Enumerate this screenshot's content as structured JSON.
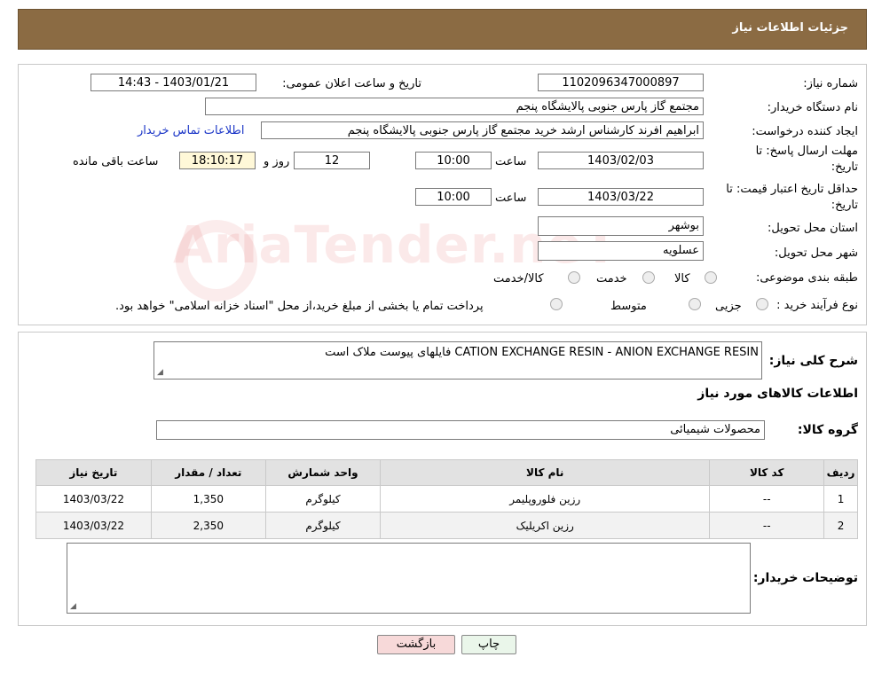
{
  "header": {
    "title": "جزئیات اطلاعات نیاز"
  },
  "form": {
    "need_number_label": "شماره نیاز:",
    "need_number": "1102096347000897",
    "announce_label": "تاریخ و ساعت اعلان عمومی:",
    "announce_value": "1403/01/21 - 14:43",
    "buyer_org_label": "نام دستگاه خریدار:",
    "buyer_org": "مجتمع گاز پارس جنوبی  پالایشگاه پنجم",
    "creator_label": "ایجاد کننده درخواست:",
    "creator": "ابراهیم افرند کارشناس ارشد خرید مجتمع گاز پارس جنوبی  پالایشگاه پنجم",
    "contact_link": "اطلاعات تماس خریدار",
    "deadline_label_1": "مهلت ارسال پاسخ: تا",
    "deadline_label_2": "تاریخ:",
    "deadline_date": "1403/02/03",
    "time_label": "ساعت",
    "deadline_time": "10:00",
    "days_value": "12",
    "days_label": "روز و",
    "remaining_time": "18:10:17",
    "remaining_label": "ساعت باقی مانده",
    "validity_label_1": "حداقل تاریخ اعتبار قیمت: تا",
    "validity_label_2": "تاریخ:",
    "validity_date": "1403/03/22",
    "validity_time": "10:00",
    "province_label": "استان محل تحویل:",
    "province": "بوشهر",
    "city_label": "شهر محل تحویل:",
    "city": "عسلویه",
    "category_label": "طبقه بندی موضوعی:",
    "category_options": [
      "کالا",
      "خدمت",
      "کالا/خدمت"
    ],
    "process_label": "نوع فرآیند خرید :",
    "process_options": [
      "جزیی",
      "متوسط"
    ],
    "process_note": "پرداخت تمام یا بخشی از مبلغ خرید،از محل \"اسناد خزانه اسلامی\" خواهد بود."
  },
  "details": {
    "description_label": "شرح کلی نیاز:",
    "description": "CATION EXCHANGE RESIN - ANION EXCHANGE RESIN فایلهای پیوست ملاک است",
    "goods_info_title": "اطلاعات کالاهای مورد نیاز",
    "goods_group_label": "گروه کالا:",
    "goods_group": "محصولات شیمیائی",
    "table": {
      "headers": [
        "ردیف",
        "کد کالا",
        "نام کالا",
        "واحد شمارش",
        "تعداد / مقدار",
        "تاریخ نیاز"
      ],
      "rows": [
        [
          "1",
          "--",
          "رزین فلوروپلیمر",
          "کیلوگرم",
          "1,350",
          "1403/03/22"
        ],
        [
          "2",
          "--",
          "رزین اکریلیک",
          "کیلوگرم",
          "2,350",
          "1403/03/22"
        ]
      ]
    },
    "buyer_notes_label": "توضیحات خریدار:",
    "buyer_notes": ""
  },
  "buttons": {
    "print": "چاپ",
    "back": "بازگشت"
  },
  "watermark": "AriaTender.neT",
  "colors": {
    "header_bg": "#8b6b43",
    "link": "#1a35c7",
    "back_button": "#f7d9d9",
    "print_button": "#eaf6ea"
  }
}
